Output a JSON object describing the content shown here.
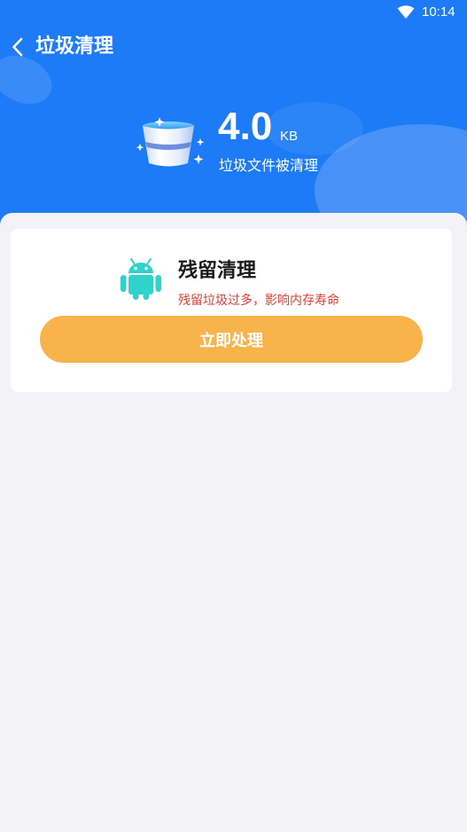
{
  "status_bar": {
    "time": "10:14",
    "icons": [
      "wifi-icon"
    ]
  },
  "header": {
    "title": "垃圾清理",
    "back_icon": "chevron-left-icon",
    "cleaned_size_value": "4.0",
    "cleaned_size_unit": "KB",
    "cleaned_caption": "垃圾文件被清理",
    "bucket_icon": "trash-bucket-icon",
    "background_color": "#1e7bf7"
  },
  "residual_card": {
    "icon": "android-icon",
    "icon_color": "#2fd3c9",
    "title": "残留清理",
    "warning": "残留垃圾过多，影响内存寿命",
    "warning_color": "#e63a2e",
    "action_label": "立即处理",
    "action_color": "#f9b34b"
  }
}
